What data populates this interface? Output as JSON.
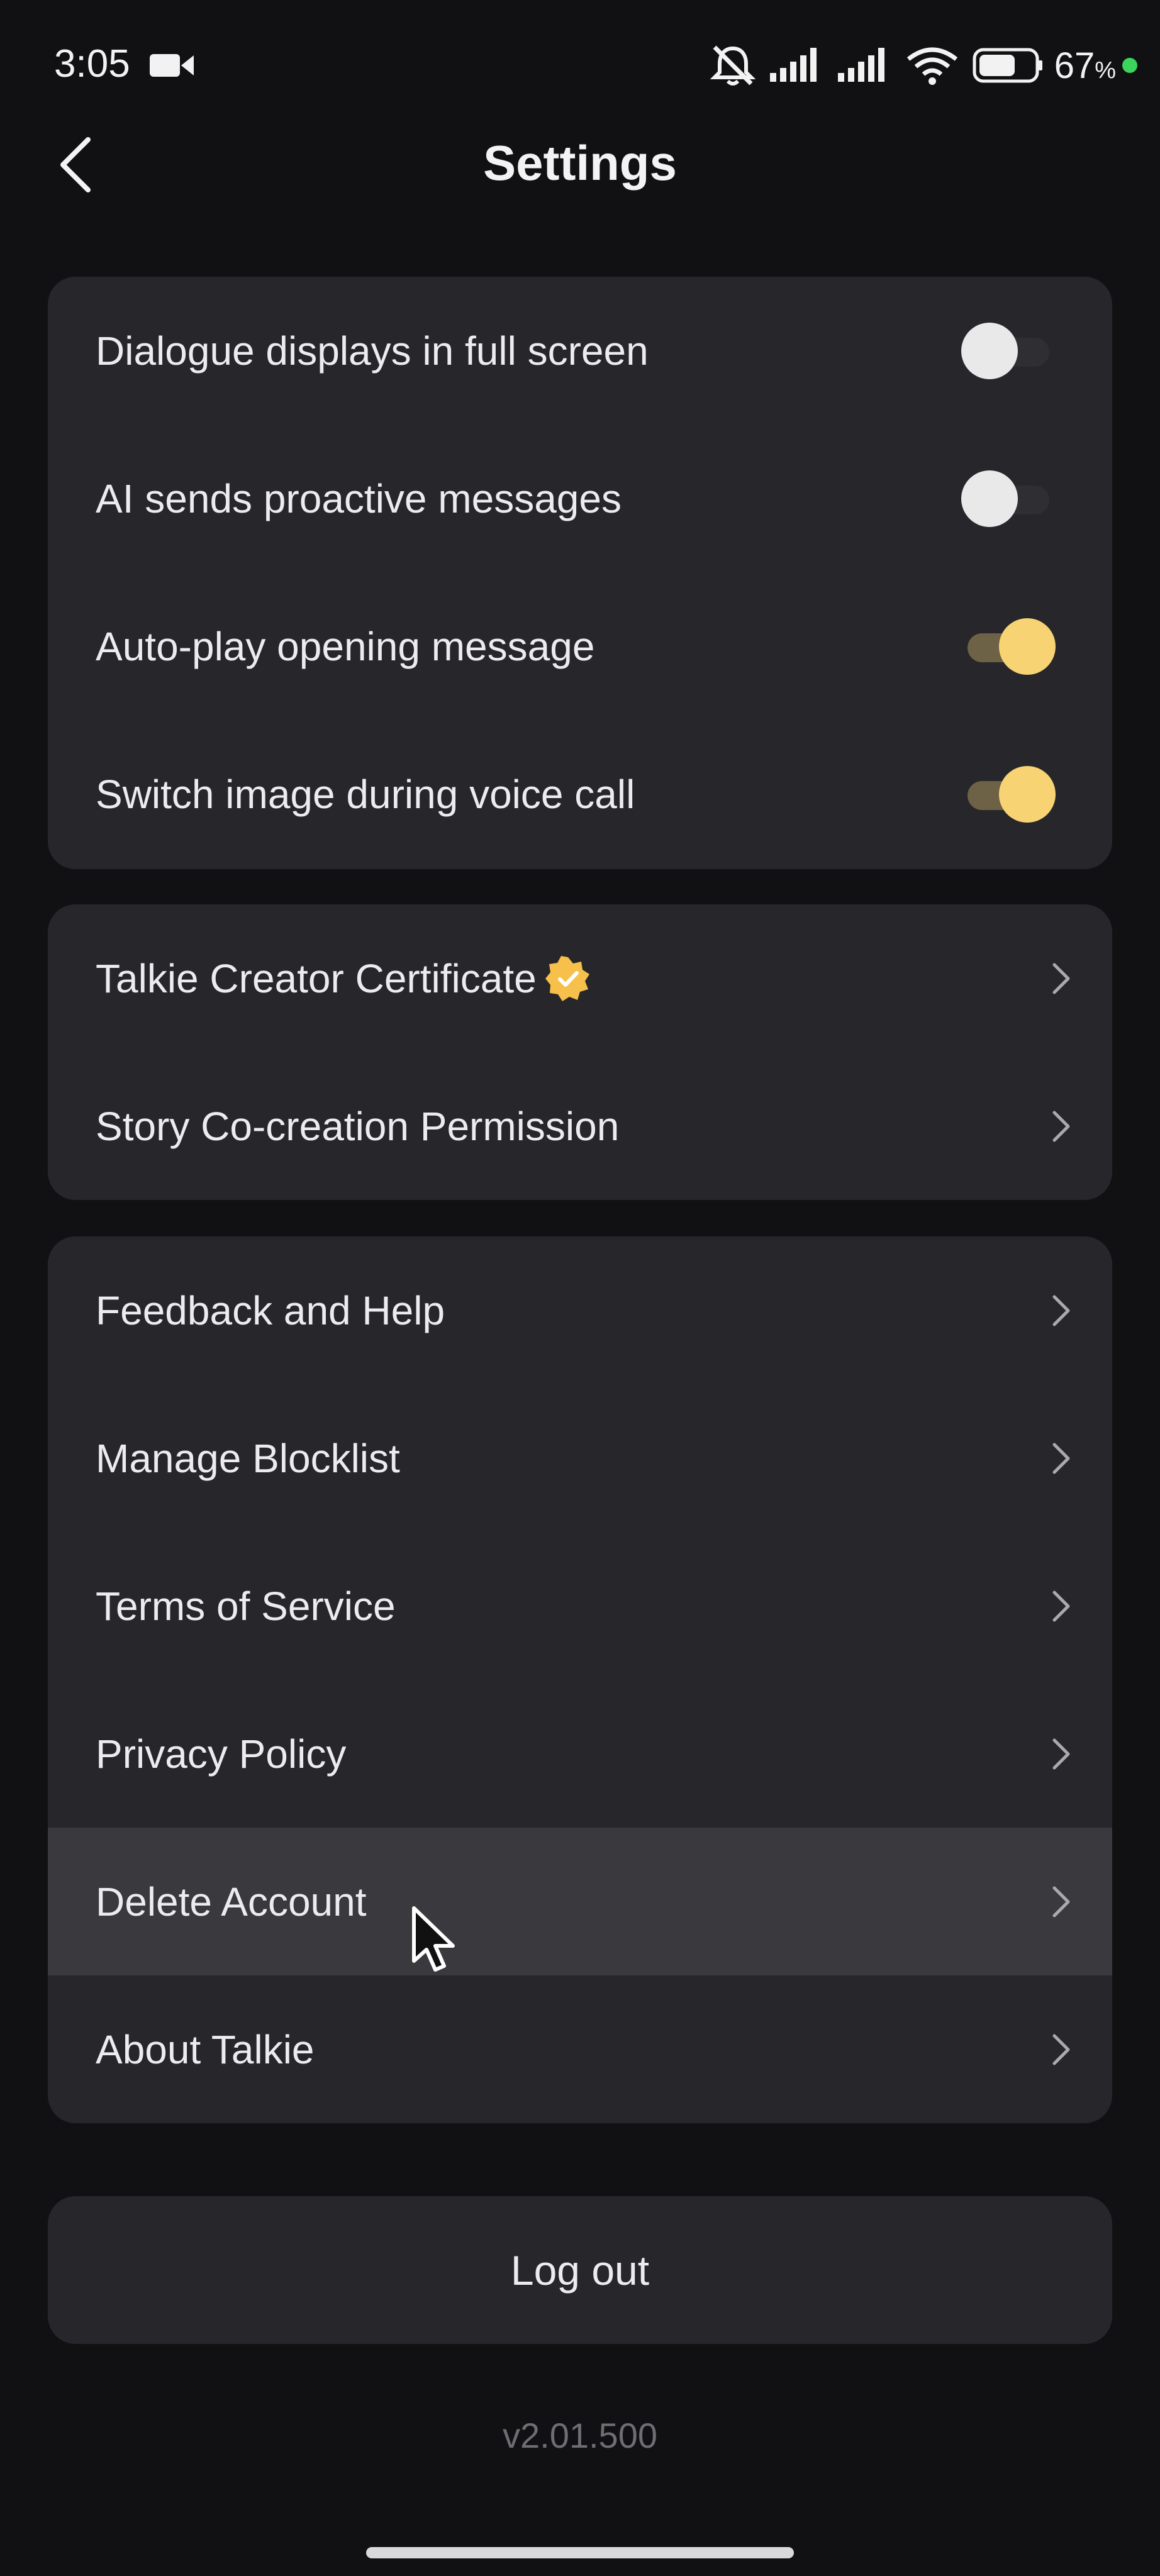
{
  "status_bar": {
    "time": "3:05",
    "battery_percent": "67",
    "battery_unit": "%",
    "icons": [
      "video-camera-icon",
      "muted-bell-icon",
      "signal-icon",
      "signal-icon",
      "wifi-icon",
      "battery-icon"
    ],
    "battery_level": 0.67,
    "charging_dot_color": "#3bd45c"
  },
  "header": {
    "title": "Settings",
    "back_icon": "chevron-left-icon"
  },
  "toggles_card": {
    "items": [
      {
        "label": "Dialogue displays in full screen",
        "on": false
      },
      {
        "label": "AI sends proactive messages",
        "on": false
      },
      {
        "label": "Auto-play opening message",
        "on": true
      },
      {
        "label": "Switch image during voice call",
        "on": true
      }
    ]
  },
  "creator_card": {
    "items": [
      {
        "label": "Talkie Creator Certificate",
        "badge_icon": "verified-badge-icon"
      },
      {
        "label": "Story Co-creation Permission"
      }
    ]
  },
  "support_card": {
    "items": [
      {
        "label": "Feedback and Help"
      },
      {
        "label": "Manage Blocklist"
      },
      {
        "label": "Terms of Service"
      },
      {
        "label": "Privacy Policy"
      },
      {
        "label": "Delete Account",
        "highlighted": true
      },
      {
        "label": "About Talkie"
      }
    ]
  },
  "logout_label": "Log out",
  "version": "v2.01.500",
  "colors": {
    "background": "#111113",
    "card": "#27272b",
    "toggle_on_knob": "#f8d373",
    "toggle_on_track": "#6d6246",
    "badge": "#f6c04a"
  }
}
